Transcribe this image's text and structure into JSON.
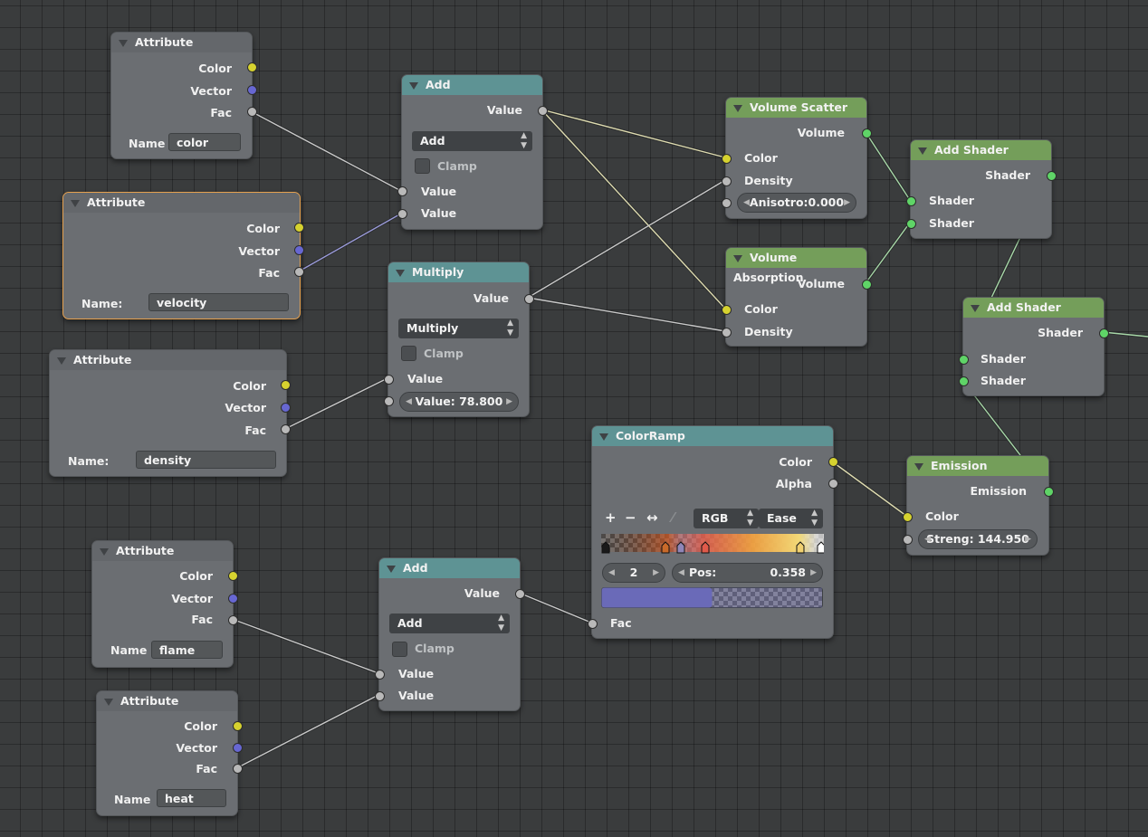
{
  "labels": {
    "color": "Color",
    "vector": "Vector",
    "fac": "Fac",
    "value": "Value",
    "clamp": "Clamp",
    "volume": "Volume",
    "density": "Density",
    "shader": "Shader",
    "emission": "Emission",
    "alpha": "Alpha",
    "name": "Name",
    "name_colon": "Name:"
  },
  "nodes": {
    "attr1": {
      "title": "Attribute",
      "name_value": "color"
    },
    "attr2": {
      "title": "Attribute",
      "name_value": "velocity"
    },
    "attr3": {
      "title": "Attribute",
      "name_value": "density"
    },
    "attr4": {
      "title": "Attribute",
      "name_value": "flame"
    },
    "attr5": {
      "title": "Attribute",
      "name_value": "heat"
    },
    "add1": {
      "title": "Add",
      "operation": "Add"
    },
    "multiply": {
      "title": "Multiply",
      "operation": "Multiply",
      "value_slider": "Value:   78.800"
    },
    "add2": {
      "title": "Add",
      "operation": "Add"
    },
    "volume_scatter": {
      "title": "Volume Scatter",
      "anisotropy": "Anisotro:0.000"
    },
    "volume_absorption": {
      "title": "Volume Absorption"
    },
    "add_shader1": {
      "title": "Add Shader"
    },
    "add_shader2": {
      "title": "Add Shader"
    },
    "colorramp": {
      "title": "ColorRamp",
      "color_mode": "RGB",
      "interpolation": "Ease",
      "stop_index": "2",
      "pos_label": "Pos:",
      "pos_value": "0.358",
      "tools": {
        "add": "+",
        "remove": "−",
        "flip": "↔",
        "eyedropper": "⁄"
      }
    },
    "emission": {
      "title": "Emission",
      "strength": "Streng: 144.950"
    }
  },
  "colors": {
    "socket_color": "#d6d22f",
    "socket_vector": "#6767d2",
    "socket_value": "#b9b9b9",
    "socket_shader": "#5fd467",
    "header_converter": "#5e9394",
    "header_shader": "#749e5a",
    "header_input": "#64676b",
    "selected_outline": "#e6a14f"
  }
}
